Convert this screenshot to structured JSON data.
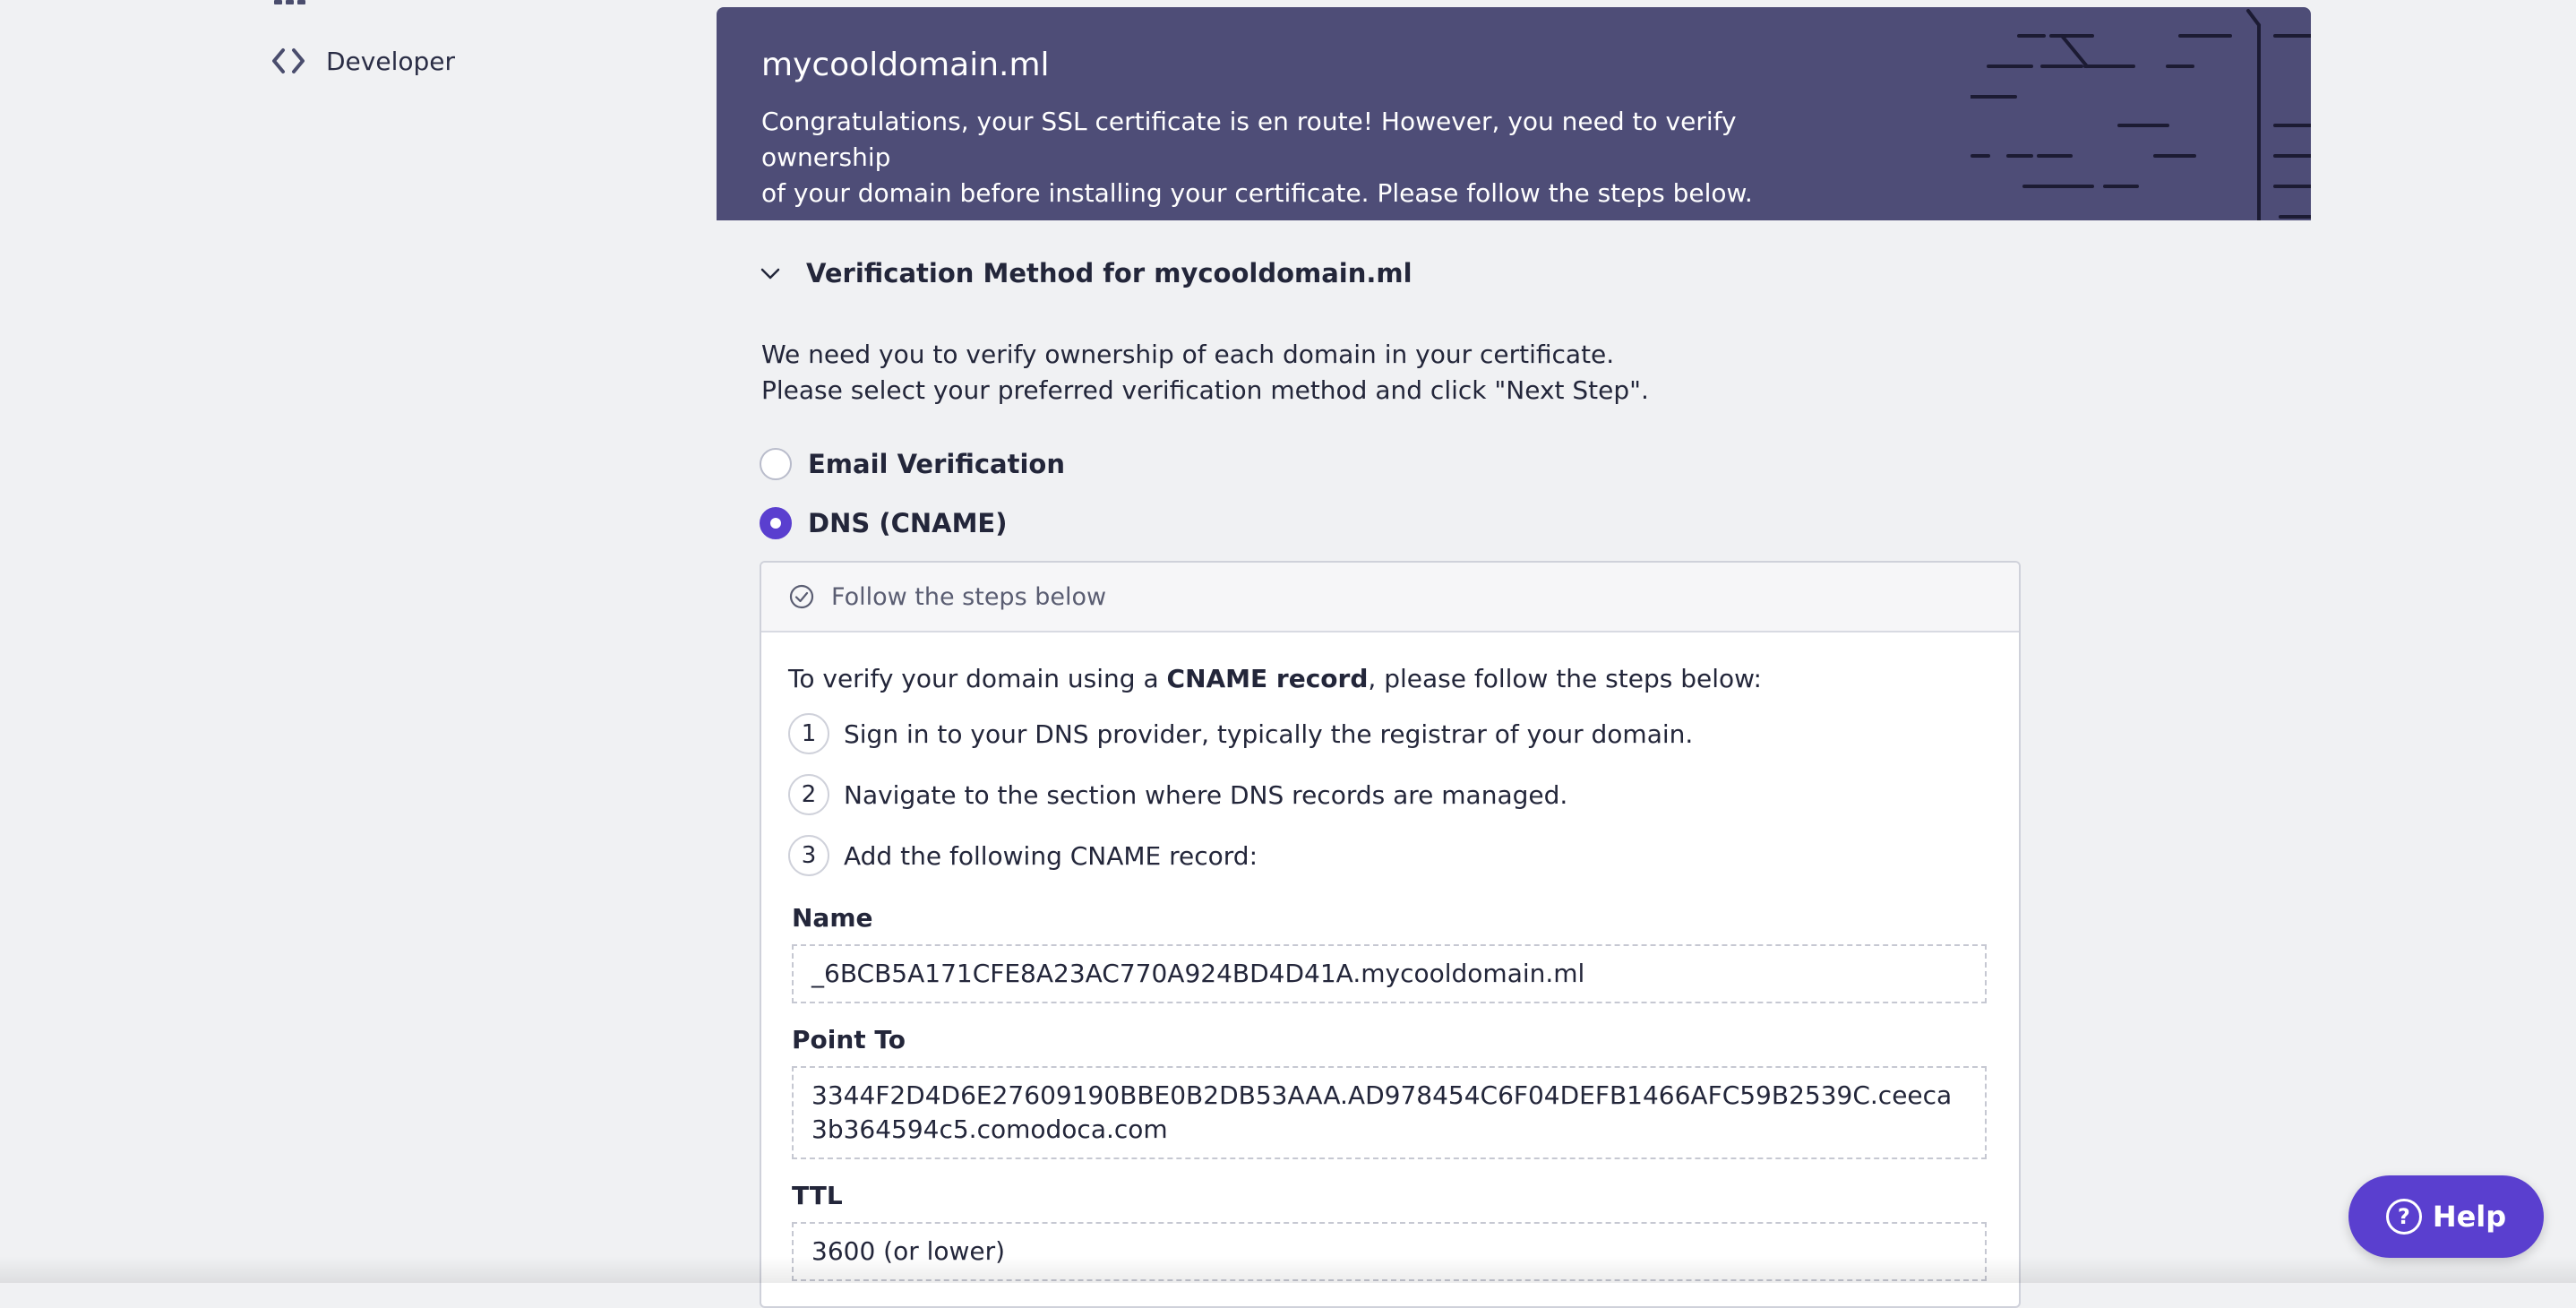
{
  "sidebar": {
    "developer_label": "Developer",
    "developer_icon": "code-brackets-icon"
  },
  "banner": {
    "title": "mycooldomain.ml",
    "message_line1": "Congratulations, your SSL certificate is en route! However, you need to verify ownership",
    "message_line2": "of your domain before installing your certificate. Please follow the steps below.",
    "background": "#4e4d77"
  },
  "verification": {
    "section_title": "Verification Method for mycooldomain.ml",
    "intro_line1": "We need you to verify ownership of each domain in your certificate.",
    "intro_line2": "Please select your preferred verification method and click \"Next Step\".",
    "options": [
      {
        "label": "Email Verification",
        "selected": false
      },
      {
        "label": "DNS (CNAME)",
        "selected": true
      }
    ],
    "accent": "#5a3fcf"
  },
  "steps": {
    "header": "Follow the steps below",
    "lead_prefix": "To verify your domain using a ",
    "lead_bold": "CNAME record",
    "lead_suffix": ", please follow the steps below:",
    "items": [
      {
        "num": "1",
        "text": "Sign in to your DNS provider, typically the registrar of your domain."
      },
      {
        "num": "2",
        "text": "Navigate to the section where DNS records are managed."
      },
      {
        "num": "3",
        "text": "Add the following CNAME record:"
      }
    ],
    "fields": {
      "name_label": "Name",
      "name_value": "_6BCB5A171CFE8A23AC770A924BD4D41A.mycooldomain.ml",
      "point_label": "Point To",
      "point_value": "3344F2D4D6E27609190BBE0B2DB53AAA.AD978454C6F04DEFB1466AFC59B2539C.ceeca3b364594c5.comodoca.com",
      "ttl_label": "TTL",
      "ttl_value": "3600 (or lower)"
    }
  },
  "help": {
    "label": "Help"
  }
}
